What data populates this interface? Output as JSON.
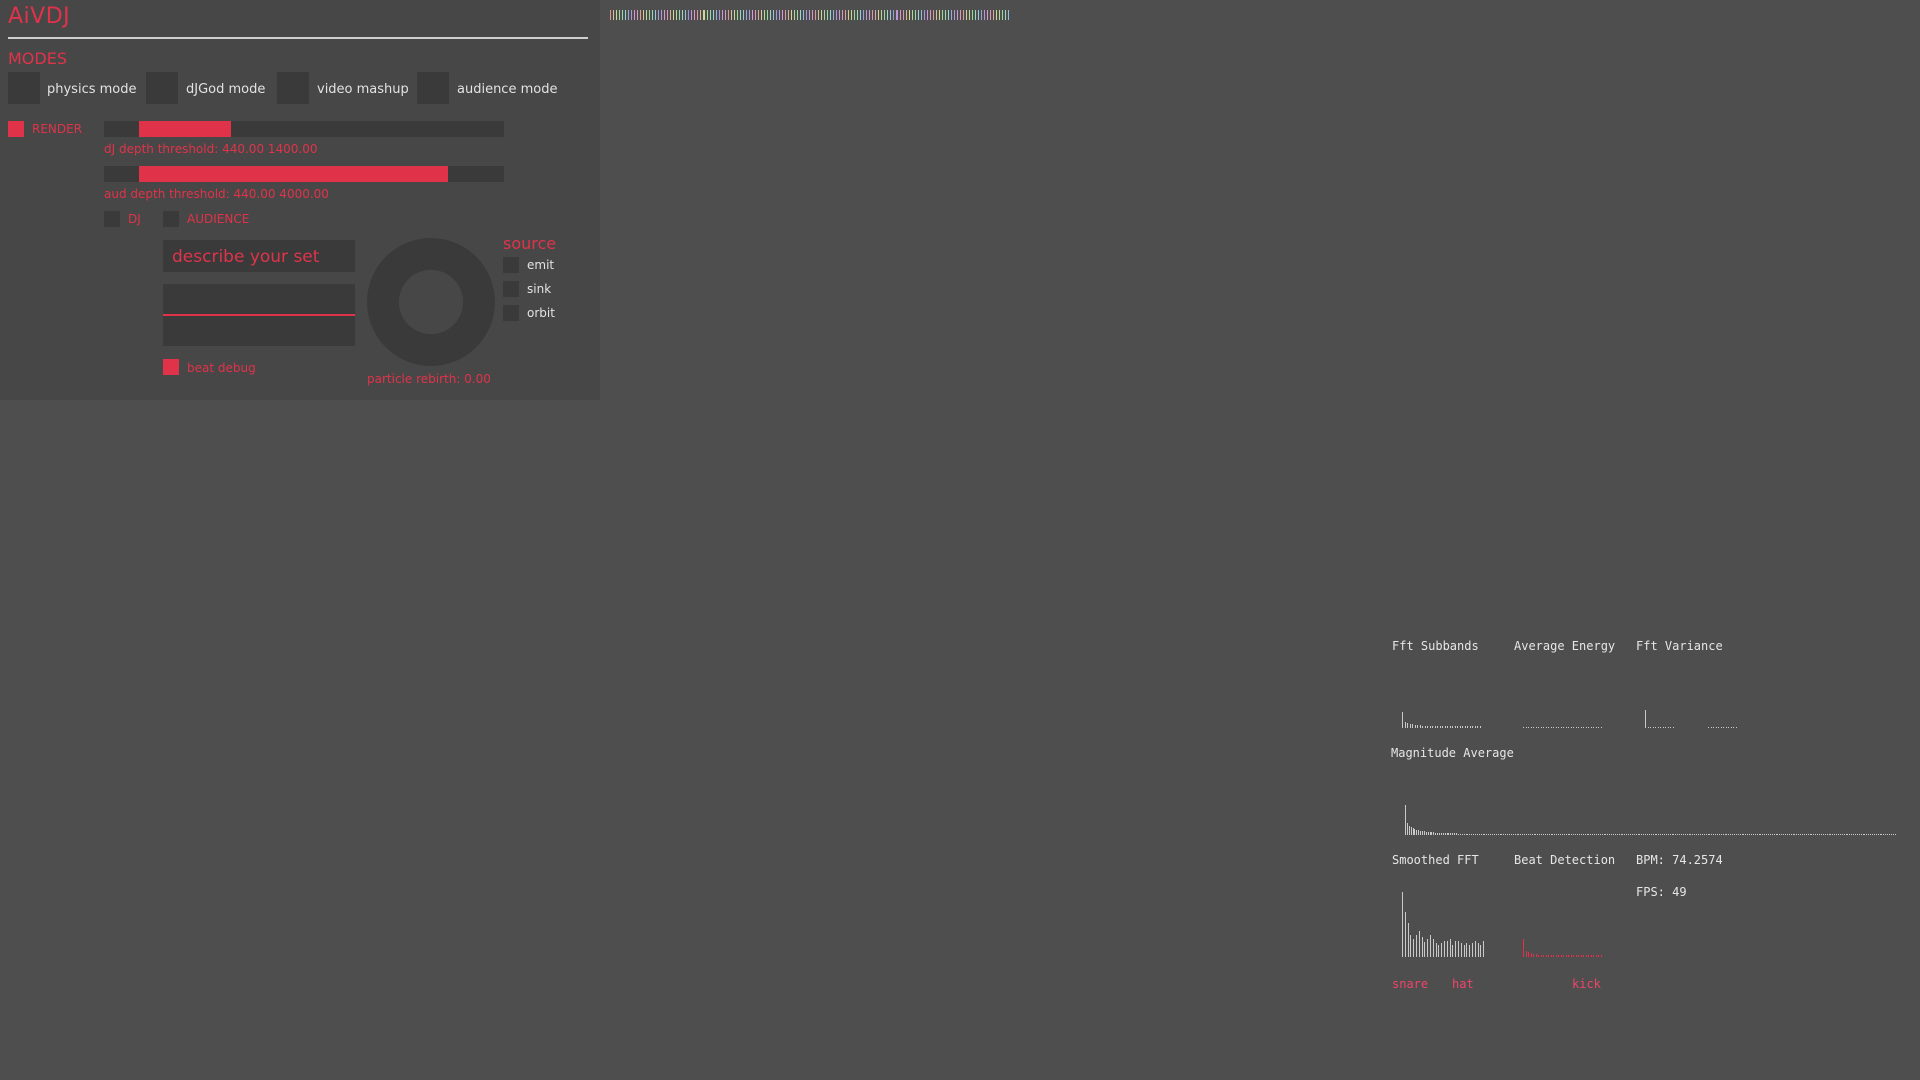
{
  "app": {
    "title": "AiVDJ"
  },
  "modes": {
    "label": "MODES",
    "items": [
      {
        "label": "physics mode"
      },
      {
        "label": "dJGod mode"
      },
      {
        "label": "video mashup"
      },
      {
        "label": "audience mode"
      }
    ]
  },
  "render": {
    "label": "RENDER",
    "checked": true
  },
  "sliders": {
    "dj_depth": {
      "label": "dJ depth threshold: 440.00 1400.00",
      "low": 440.0,
      "high": 1400.0
    },
    "aud_depth": {
      "label": "aud depth threshold: 440.00 4000.00",
      "low": 440.0,
      "high": 4000.0
    }
  },
  "targets": {
    "dj_label": "DJ",
    "audience_label": "AUDIENCE"
  },
  "describe": {
    "text": "describe your set",
    "second_value": ""
  },
  "beat_debug": {
    "label": "beat debug",
    "checked": true
  },
  "particle": {
    "label": "particle rebirth: 0.00",
    "value": 0.0
  },
  "source": {
    "title": "source",
    "options": [
      {
        "label": "emit"
      },
      {
        "label": "sink"
      },
      {
        "label": "orbit"
      }
    ]
  },
  "audio": {
    "fft_subbands": "Fft Subbands",
    "average_energy": "Average Energy",
    "fft_variance": "Fft Variance",
    "magnitude_average": "Magnitude Average",
    "smoothed_fft": "Smoothed FFT",
    "beat_detection": "Beat Detection",
    "bpm": "BPM: 74.2574",
    "fps": "FPS: 49",
    "snare": "snare",
    "hat": "hat",
    "kick": "kick"
  },
  "colors": {
    "accent": "#e0334a",
    "background": "#4e4e4e",
    "panel": "#474747",
    "control": "#3a3a3a"
  }
}
